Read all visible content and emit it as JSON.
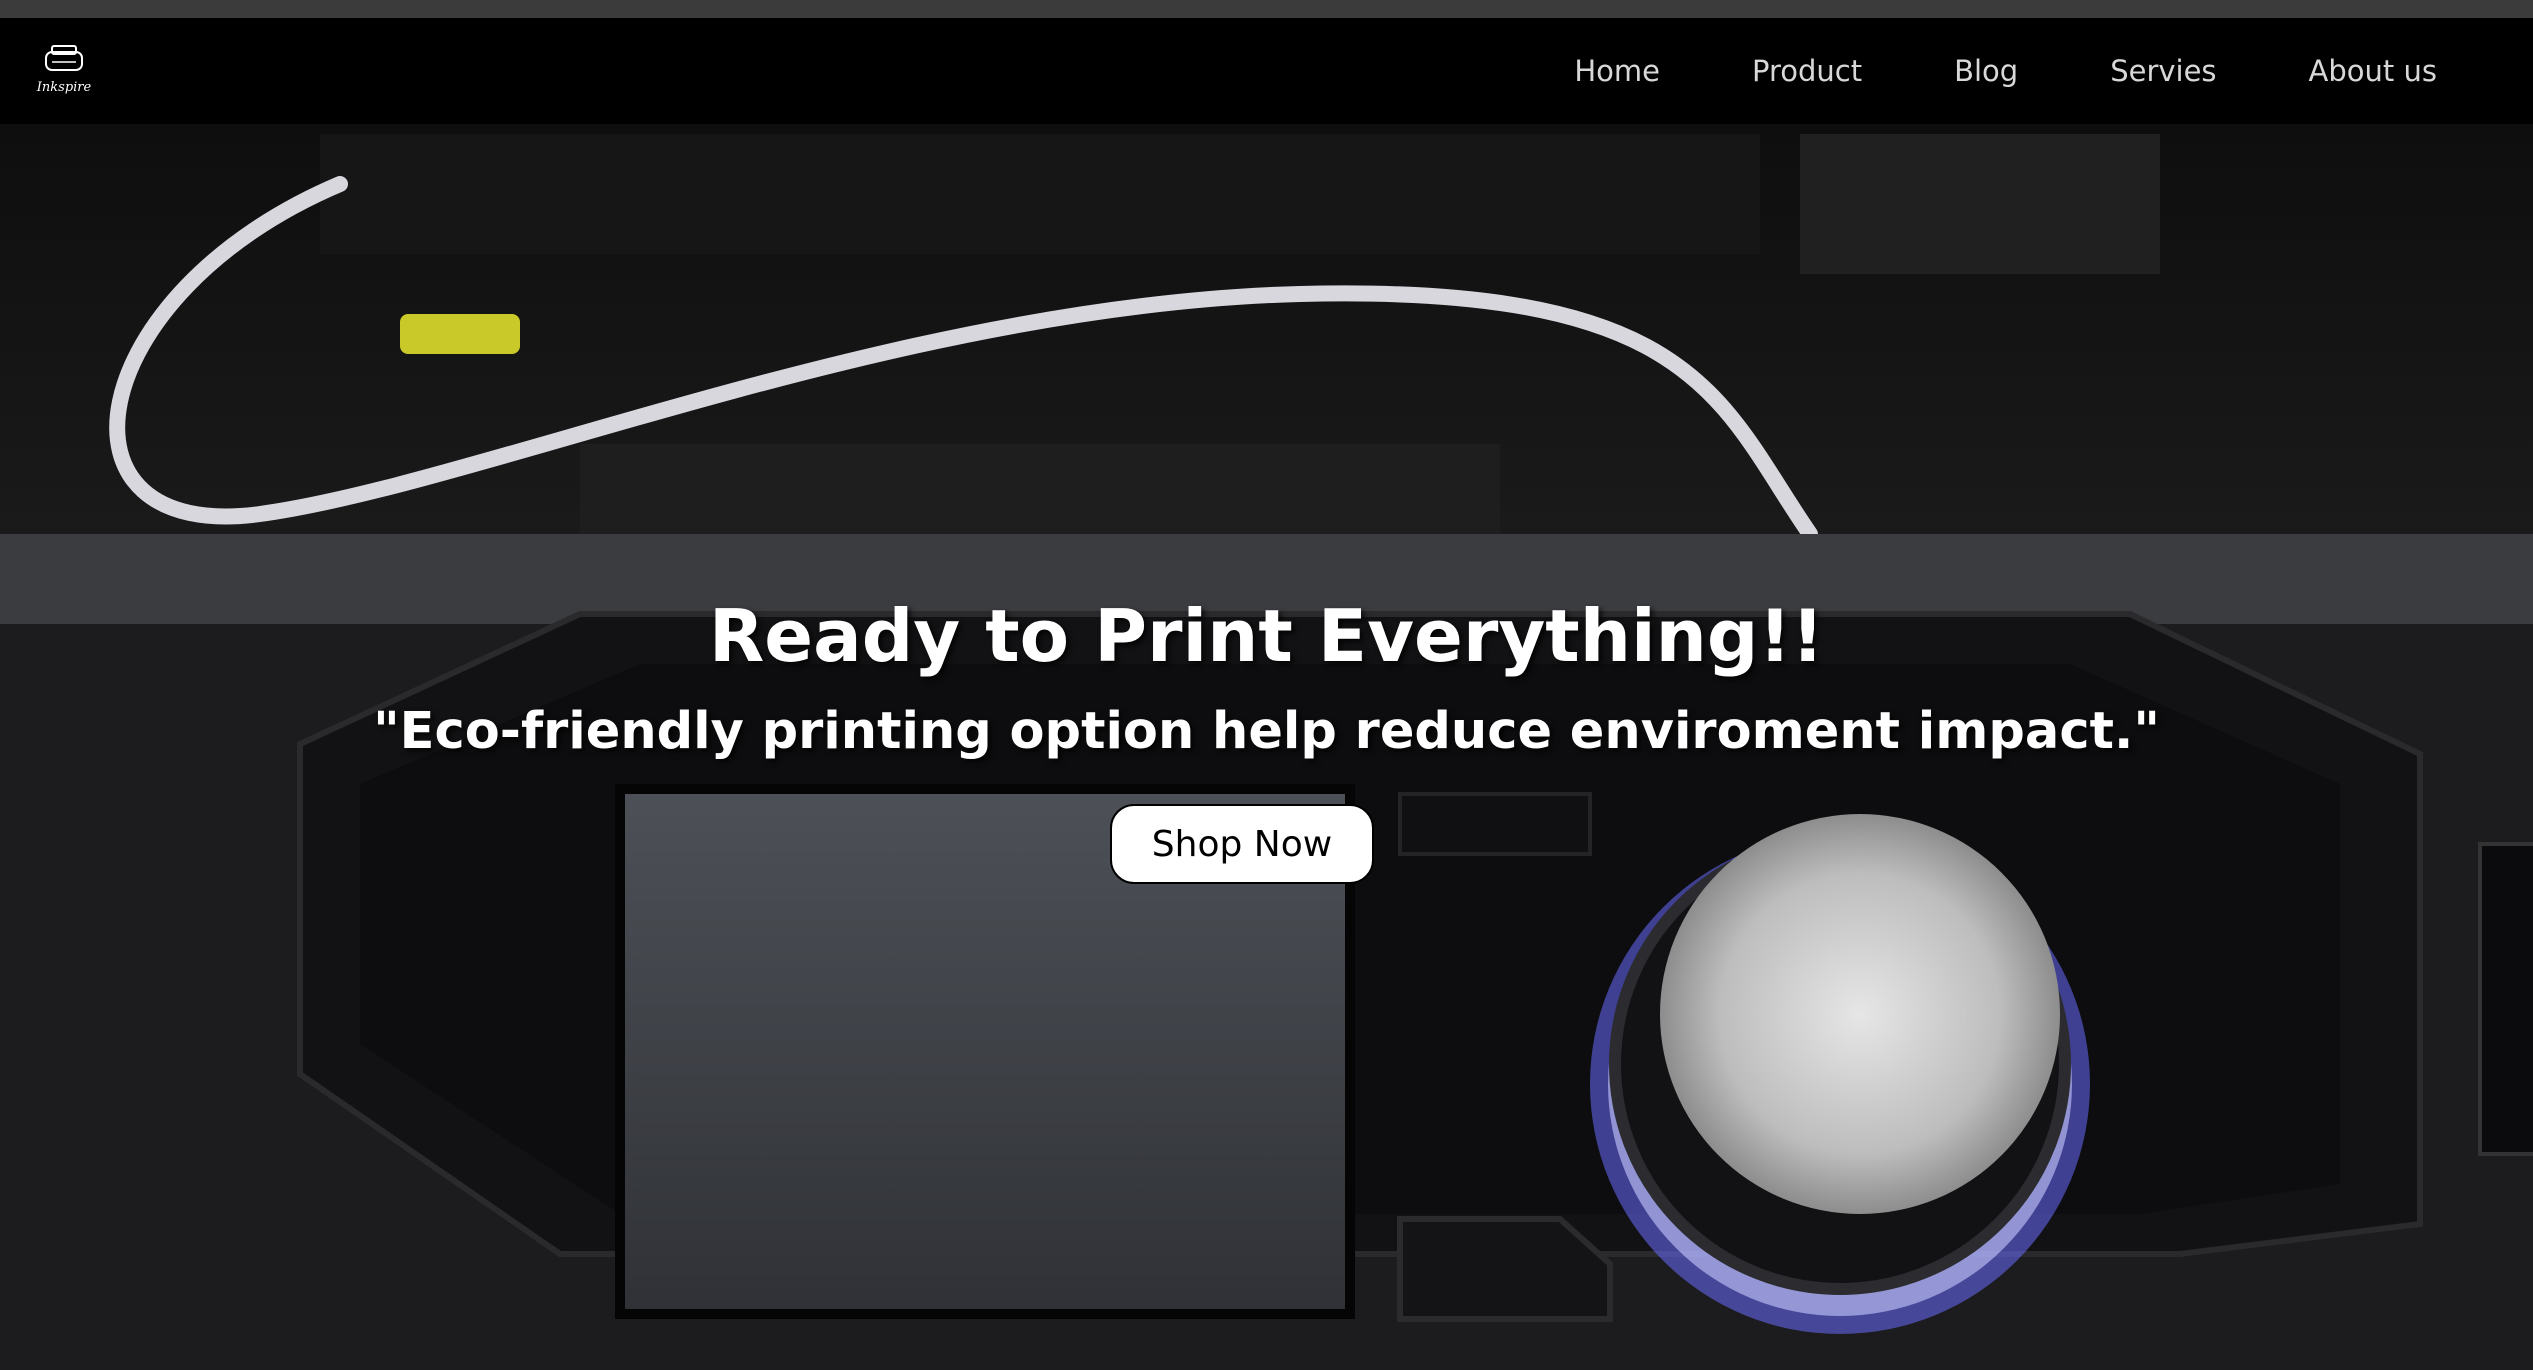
{
  "brand": {
    "logo_text": "Inkspire"
  },
  "nav": {
    "items": [
      {
        "label": "Home"
      },
      {
        "label": "Product"
      },
      {
        "label": "Blog"
      },
      {
        "label": "Servies"
      },
      {
        "label": "About us"
      }
    ]
  },
  "hero": {
    "title": "Ready to Print Everything!!",
    "subtitle": "\"Eco-friendly printing option help reduce enviroment impact.\"",
    "cta_label": "Shop Now",
    "knob_ring_color": "#6a6cff"
  }
}
